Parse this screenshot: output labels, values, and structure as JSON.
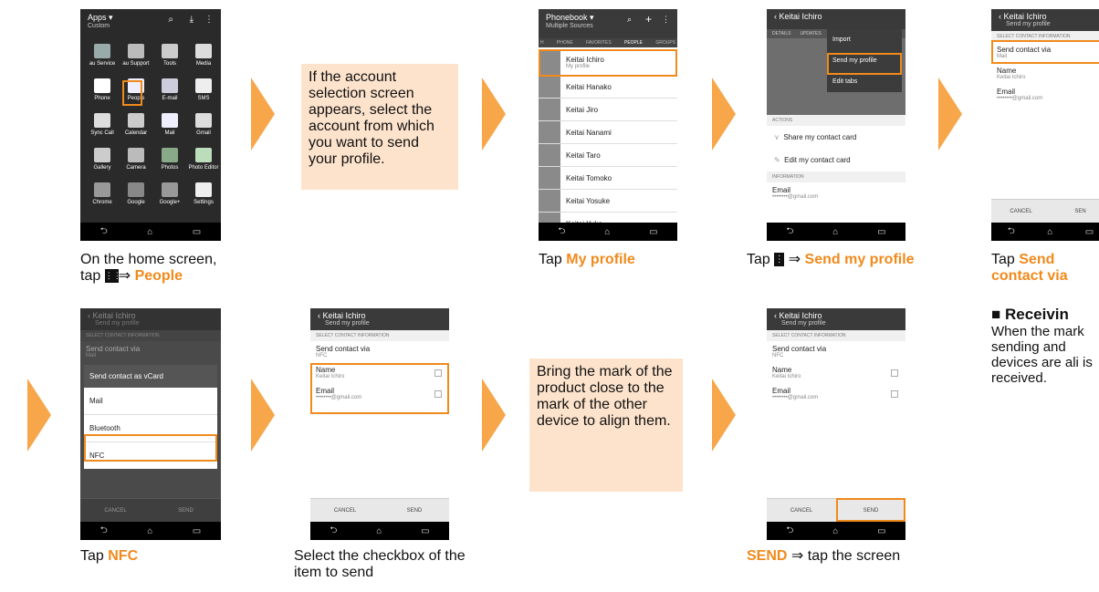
{
  "notes": {
    "n1": "If the account selection screen appears, select the account from which you want to send your profile.",
    "n2": "Bring the mark of the product close to the mark of the other device to align them."
  },
  "captions": {
    "c1_pre": "On the home screen,",
    "c1_tap": "tap",
    "c1_hl": "People",
    "c2_pre": "Tap",
    "c2_hl": "My profile",
    "c3_pre": "Tap",
    "c3_hl": "Send my profile",
    "c4_pre": "Tap",
    "c4_hl": "Send contact via",
    "c5_pre": "Tap",
    "c5_hl": "NFC",
    "c6": "Select the checkbox of the item to send",
    "c7_hl": "SEND",
    "c7_post": "⇒ tap the screen"
  },
  "receiving": {
    "title": "■ Receivin",
    "body": "When the mark sending and devices are ali is received."
  },
  "screens": {
    "apps": {
      "title": "Apps ▾",
      "subtitle": "Custom",
      "apps": [
        "au Service",
        "au Support",
        "Tools",
        "Media",
        "Phone",
        "People",
        "E-mail",
        "SMS",
        "Sync Call",
        "Calendar",
        "Mail",
        "Gmail",
        "Gallery",
        "Camera",
        "Photos",
        "Photo Editor",
        "Chrome",
        "Google",
        "Google+",
        "Settings"
      ]
    },
    "phonebook": {
      "title": "Phonebook ▾",
      "subtitle": "Multiple Sources",
      "tabs": [
        "H",
        "PHONE",
        "FAVORITES",
        "PEOPLE",
        "GROUPS"
      ],
      "contacts": [
        "Keitai Ichiro",
        "Keitai Hanako",
        "Keitai Jiro",
        "Keitai Nanami",
        "Keitai Taro",
        "Keitai Tomoko",
        "Keitai Yosuke",
        "Keitai Yuko"
      ],
      "my_profile": "My profile"
    },
    "profile": {
      "title": "Keitai Ichiro",
      "subtitle": "My profile",
      "tabs": [
        "DETAILS",
        "UPDATES"
      ],
      "menu": [
        "Import",
        "Send my profile",
        "Edit tabs"
      ],
      "actions_label": "ACTIONS",
      "share": "Share my contact card",
      "edit": "Edit my contact card",
      "info_label": "INFORMATION",
      "email_label": "Email",
      "email_value": "••••••••@gmail.com"
    },
    "send": {
      "title": "Keitai Ichiro",
      "subtitle": "Send my profile",
      "section": "SELECT CONTACT INFORMATION",
      "via_label": "Send contact via",
      "via_mail": "Mail",
      "via_nfc": "NFC",
      "name_label": "Name",
      "name_value": "Keitai Ichiro",
      "email_label": "Email",
      "email_value": "••••••••@gmail.com",
      "cancel": "CANCEL",
      "send": "SEND",
      "send_short": "SEN"
    },
    "dialog": {
      "title": "Send contact as vCard",
      "options": [
        "Mail",
        "Bluetooth",
        "NFC"
      ]
    }
  },
  "colors": {
    "accent": "#f08a1c",
    "note_bg": "#fde3cc",
    "arrow": "#f7a64a"
  }
}
